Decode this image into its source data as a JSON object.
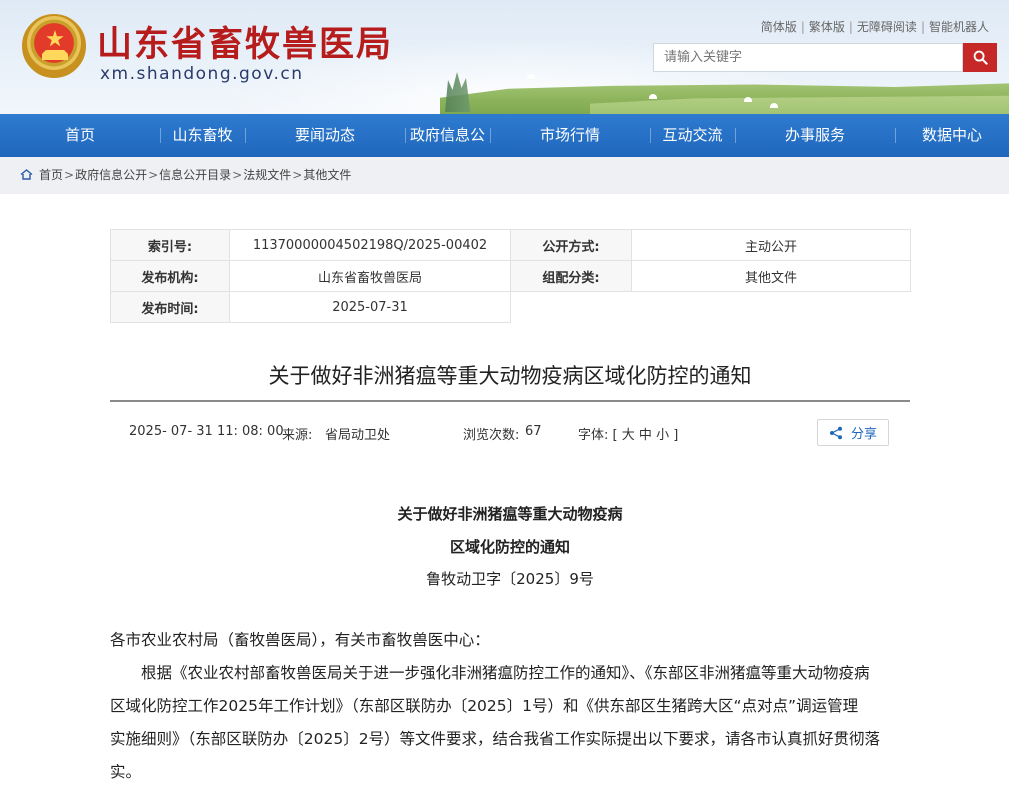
{
  "header": {
    "site_title": "山东省畜牧兽医局",
    "site_domain": "xm.shandong.gov.cn",
    "top_links": [
      "简体版",
      "繁体版",
      "无障碍阅读",
      "智能机器人"
    ],
    "search_placeholder": "请输入关键字"
  },
  "nav": {
    "items": [
      "首页",
      "山东畜牧",
      "要闻动态",
      "政府信息公开",
      "市场行情",
      "互动交流",
      "办事服务",
      "数据中心"
    ]
  },
  "breadcrumb": [
    "首页",
    "政府信息公开",
    "信息公开目录",
    "法规文件",
    "其他文件"
  ],
  "meta": {
    "index_label": "索引号:",
    "index_value": "11370000004502198Q/2025-00402",
    "publish_mode_label": "公开方式:",
    "publish_mode_value": "主动公开",
    "org_label": "发布机构:",
    "org_value": "山东省畜牧兽医局",
    "category_label": "组配分类:",
    "category_value": "其他文件",
    "date_label": "发布时间:",
    "date_value": "2025-07-31"
  },
  "article": {
    "title": "关于做好非洲猪瘟等重大动物疫病区域化防控的通知",
    "datetime": "2025- 07- 31 11: 08: 00",
    "source_label": "来源:",
    "source_value": "省局动卫处",
    "views_label": "浏览次数:",
    "views_value": "67",
    "font_label": "字体:",
    "font_open": "[",
    "font_large": "大",
    "font_medium": "中",
    "font_small": "小",
    "font_close": "]",
    "share_label": "分享",
    "doc_title_line1": "关于做好非洲猪瘟等重大动物疫病",
    "doc_title_line2": "区域化防控的通知",
    "doc_number": "鲁牧动卫字〔2025〕9号",
    "salutation": "各市农业农村局（畜牧兽医局），有关市畜牧兽医中心：",
    "body_lines": [
      "　　根据《农业农村部畜牧兽医局关于进一步强化非洲猪瘟防控工作的通知》、《东部区非洲猪瘟等重大动物疫病",
      "区域化防控工作2025年工作计划》（东部区联防办〔2025〕1号）和《供东部区生猪跨大区“点对点”调运管理",
      "实施细则》（东部区联防办〔2025〕2号）等文件要求，结合我省工作实际提出以下要求，请各市认真抓好贯彻落",
      "实。"
    ]
  },
  "colors": {
    "brand_red": "#b71c1c",
    "nav_blue": "#1f67bd",
    "search_red": "#c62828"
  }
}
